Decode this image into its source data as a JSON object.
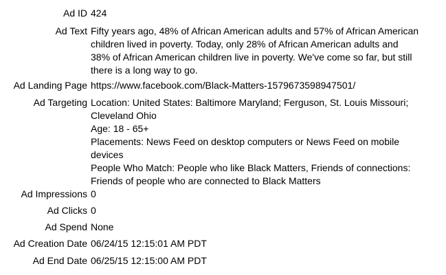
{
  "fields": {
    "ad_id": {
      "label": "Ad ID",
      "value": "424"
    },
    "ad_text": {
      "label": "Ad Text",
      "lines": [
        "Fifty years ago, 48% of African American adults and 57% of African American",
        "children lived in poverty. Today, only 28% of African American adults and",
        "38% of African American children live in poverty. We've come so far, but still",
        "there is a long way to go."
      ]
    },
    "ad_landing_page": {
      "label": "Ad Landing Page",
      "value": "https://www.facebook.com/Black-Matters-1579673598947501/"
    },
    "ad_targeting": {
      "label": "Ad Targeting",
      "lines": [
        "Location: United States: Baltimore Maryland; Ferguson, St. Louis Missouri;",
        "Cleveland Ohio",
        "Age: 18 - 65+",
        "Placements: News Feed on desktop computers or News Feed on mobile",
        "devices",
        "People Who Match: People who like Black Matters, Friends of connections:",
        "Friends of people who are connected to Black Matters"
      ]
    },
    "ad_impressions": {
      "label": "Ad Impressions",
      "value": "0"
    },
    "ad_clicks": {
      "label": "Ad Clicks",
      "value": "0"
    },
    "ad_spend": {
      "label": "Ad Spend",
      "value": "None"
    },
    "ad_creation_date": {
      "label": "Ad Creation Date",
      "value": "06/24/15 12:15:01 AM PDT"
    },
    "ad_end_date": {
      "label": "Ad End Date",
      "value": "06/25/15 12:15:00 AM PDT"
    }
  }
}
